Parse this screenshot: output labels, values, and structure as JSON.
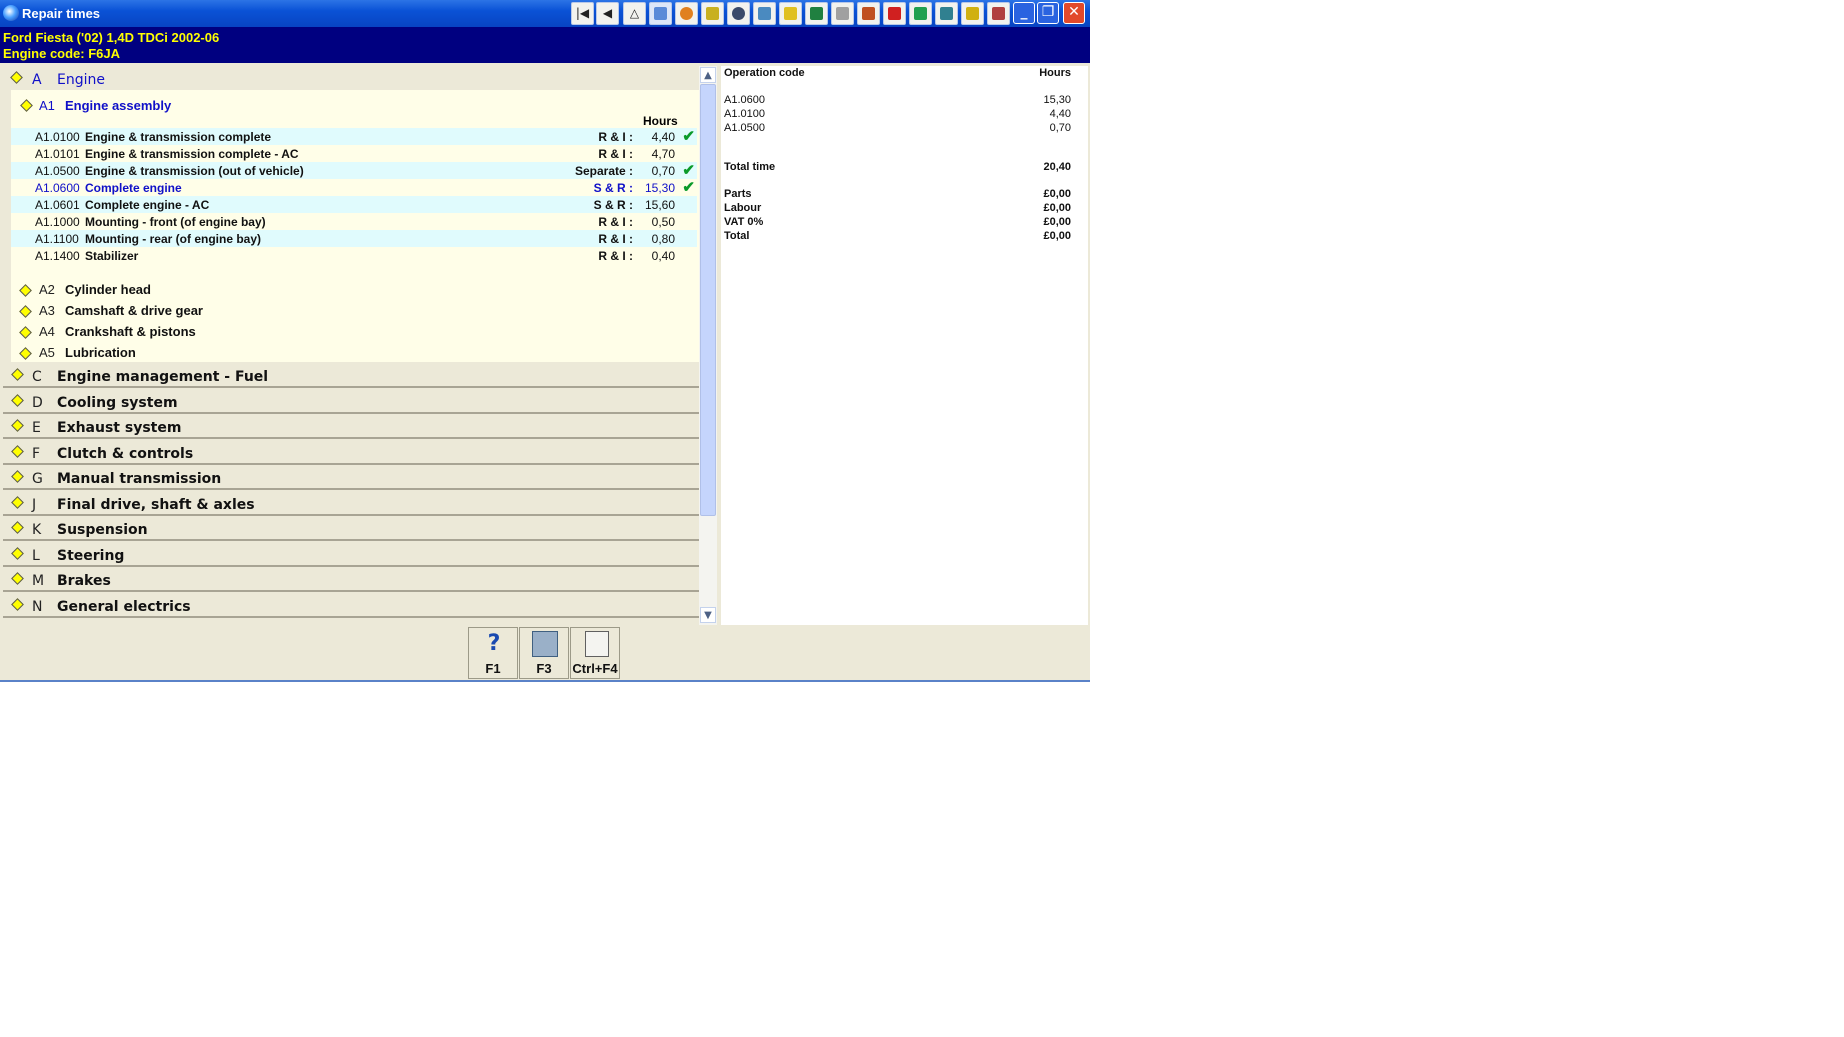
{
  "window": {
    "title": "Repair times",
    "controls": [
      "minimize",
      "maximize",
      "close"
    ]
  },
  "toolbar_icons": [
    "first-icon",
    "back-icon",
    "warning-icon",
    "diagram-icon",
    "wheel-icon",
    "tools-icon",
    "tire-icon",
    "engine-icon",
    "battery-icon",
    "door-icon",
    "lift-icon",
    "book-icon",
    "car-red-icon",
    "data-icon",
    "plug-icon",
    "key-icon",
    "printer-icon"
  ],
  "vehicle": {
    "line1": "Ford   Fiesta ('02) 1,4D TDCi 2002-06",
    "line2": "Engine code: F6JA"
  },
  "tree": {
    "open_section": {
      "letter": "A",
      "name": "Engine"
    },
    "open_subsection": {
      "letter": "A1",
      "name": "Engine assembly"
    },
    "hours_header": "Hours",
    "operations": [
      {
        "code": "A1.0100",
        "name": "Engine & transmission complete",
        "type": "R & I :",
        "hours": "4,40",
        "checked": true
      },
      {
        "code": "A1.0101",
        "name": "Engine & transmission complete - AC",
        "type": "R & I :",
        "hours": "4,70",
        "checked": false
      },
      {
        "code": "A1.0500",
        "name": "Engine & transmission (out of vehicle)",
        "type": "Separate :",
        "hours": "0,70",
        "checked": true
      },
      {
        "code": "A1.0600",
        "name": "Complete engine",
        "type": "S & R :",
        "hours": "15,30",
        "checked": true
      },
      {
        "code": "A1.0601",
        "name": "Complete engine - AC",
        "type": "S & R :",
        "hours": "15,60",
        "checked": false
      },
      {
        "code": "A1.1000",
        "name": "Mounting - front (of engine bay)",
        "type": "R & I :",
        "hours": "0,50",
        "checked": false
      },
      {
        "code": "A1.1100",
        "name": "Mounting - rear (of engine bay)",
        "type": "R & I :",
        "hours": "0,80",
        "checked": false
      },
      {
        "code": "A1.1400",
        "name": "Stabilizer",
        "type": "R & I :",
        "hours": "0,40",
        "checked": false
      }
    ],
    "subsections": [
      {
        "letter": "A2",
        "name": "Cylinder head"
      },
      {
        "letter": "A3",
        "name": "Camshaft & drive gear"
      },
      {
        "letter": "A4",
        "name": "Crankshaft & pistons"
      },
      {
        "letter": "A5",
        "name": "Lubrication"
      }
    ],
    "sections": [
      {
        "letter": "C",
        "name": "Engine management - Fuel"
      },
      {
        "letter": "D",
        "name": "Cooling system"
      },
      {
        "letter": "E",
        "name": "Exhaust system"
      },
      {
        "letter": "F",
        "name": "Clutch & controls"
      },
      {
        "letter": "G",
        "name": "Manual transmission"
      },
      {
        "letter": "J",
        "name": "Final drive, shaft & axles"
      },
      {
        "letter": "K",
        "name": "Suspension"
      },
      {
        "letter": "L",
        "name": "Steering"
      },
      {
        "letter": "M",
        "name": "Brakes"
      },
      {
        "letter": "N",
        "name": "General electrics"
      }
    ]
  },
  "summary": {
    "col_code": "Operation code",
    "col_hours": "Hours",
    "items": [
      {
        "code": "A1.0600",
        "hours": "15,30"
      },
      {
        "code": "A1.0100",
        "hours": "4,40"
      },
      {
        "code": "A1.0500",
        "hours": "0,70"
      }
    ],
    "total_time_label": "Total time",
    "total_time": "20,40",
    "costs": [
      {
        "label": "Parts",
        "value": "£0,00"
      },
      {
        "label": "Labour",
        "value": "£0,00"
      },
      {
        "label": "VAT 0%",
        "value": "£0,00"
      },
      {
        "label": "Total",
        "value": "£0,00"
      }
    ]
  },
  "function_keys": [
    {
      "label": "F1",
      "icon": "help-icon"
    },
    {
      "label": "F3",
      "icon": "notepad-icon"
    },
    {
      "label": "Ctrl+F4",
      "icon": "clipboard-icon"
    }
  ],
  "colors": {
    "title_bar": "#0a52d6",
    "vehicle_bg": "#000080",
    "vehicle_text": "#ffff00",
    "selected_text": "#1010c8",
    "check": "#0a9a2a"
  }
}
